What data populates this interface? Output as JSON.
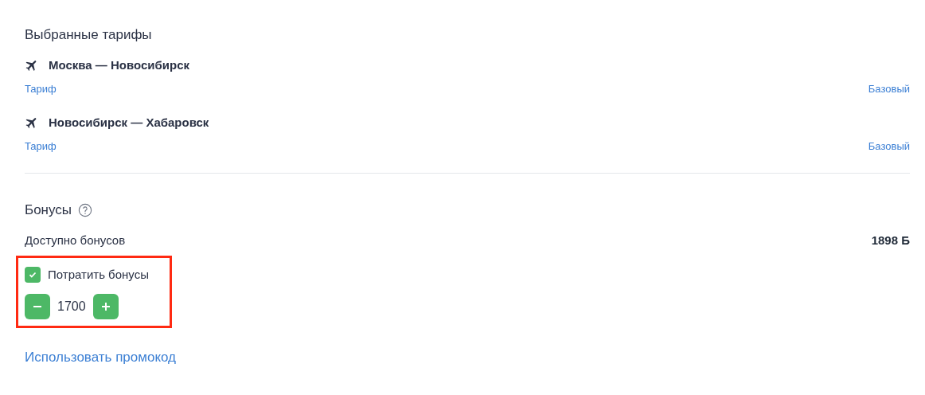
{
  "fares": {
    "title": "Выбранные тарифы",
    "items": [
      {
        "route": "Москва — Новосибирск",
        "label": "Тариф",
        "value": "Базовый"
      },
      {
        "route": "Новосибирск — Хабаровск",
        "label": "Тариф",
        "value": "Базовый"
      }
    ]
  },
  "bonuses": {
    "title": "Бонусы",
    "available_label": "Доступно бонусов",
    "available_value": "1898 Б",
    "spend": {
      "label": "Потратить бонусы",
      "checked": true,
      "highlighted": true,
      "amount": "1700"
    }
  },
  "promo_link": "Использовать промокод"
}
